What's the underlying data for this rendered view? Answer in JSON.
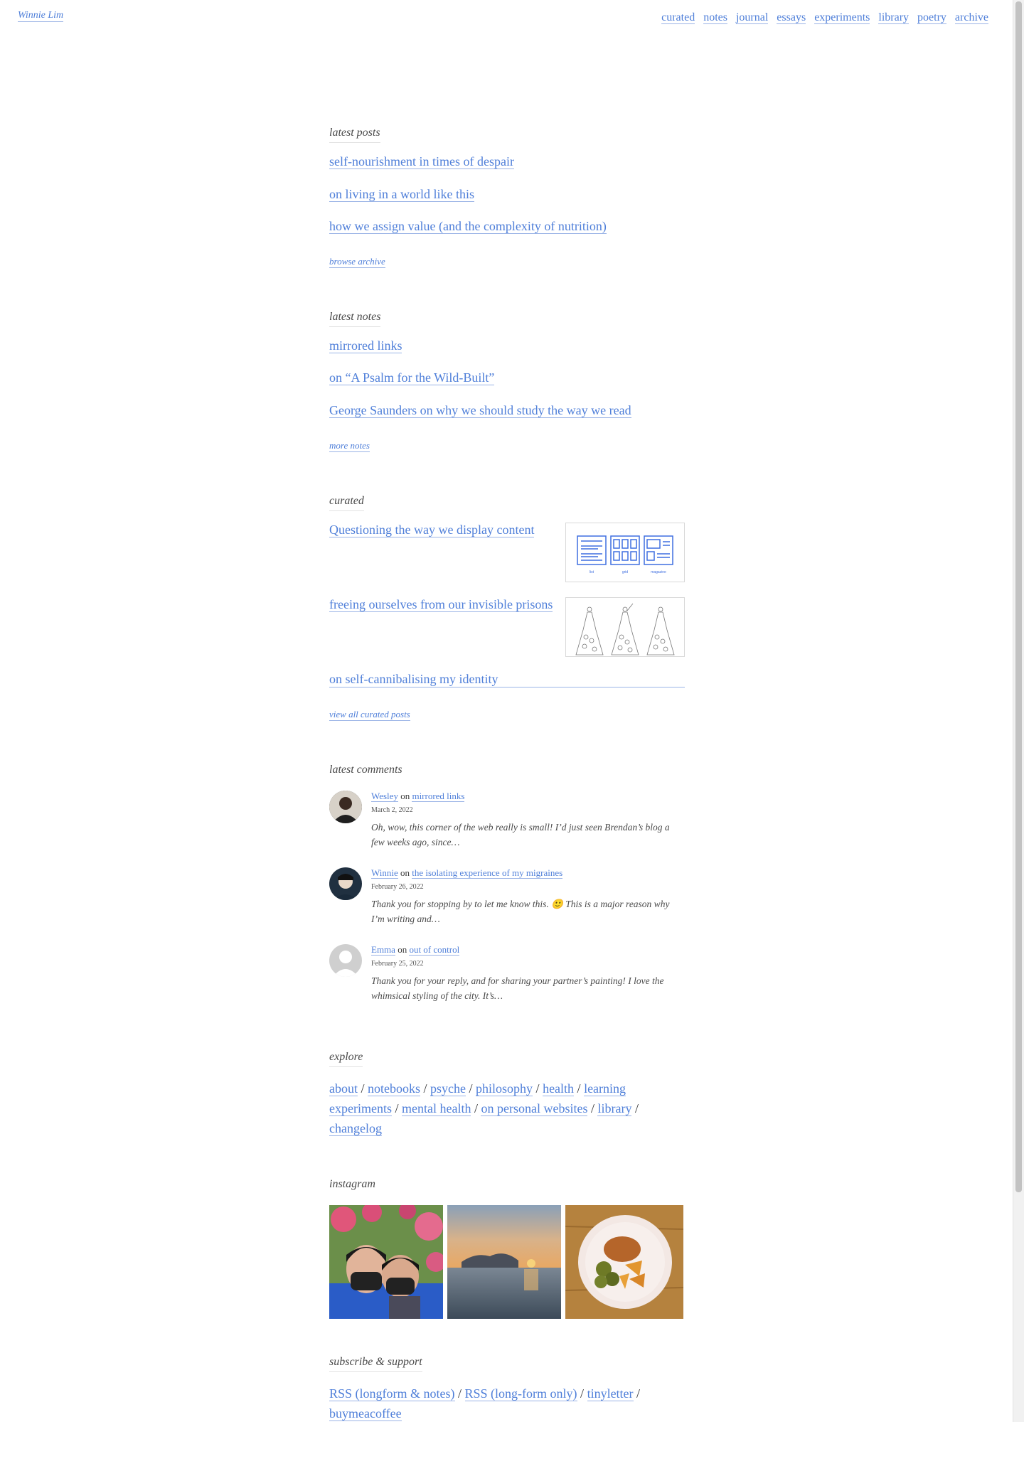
{
  "site": {
    "title": "Winnie Lim"
  },
  "nav": [
    "curated",
    "notes",
    "journal",
    "essays",
    "experiments",
    "library",
    "poetry",
    "archive"
  ],
  "latest_posts": {
    "label": "latest posts",
    "items": [
      "self-nourishment in times of despair",
      "on living in a world like this",
      "how we assign value (and the complexity of nutrition)"
    ],
    "more": "browse archive"
  },
  "latest_notes": {
    "label": "latest notes",
    "items": [
      "mirrored links",
      "on “A Psalm for the Wild-Built”",
      "George Saunders on why we should study the way we read"
    ],
    "more": "more notes"
  },
  "curated": {
    "label": "curated",
    "items": [
      {
        "title": "Questioning the way we display content",
        "thumb": "list-grid-magazine-layouts"
      },
      {
        "title": "freeing ourselves from our invisible prisons",
        "thumb": "three-figure-line-drawing"
      },
      {
        "title": "on self-cannibalising my identity"
      }
    ],
    "diagram_labels": [
      "list",
      "grid",
      "magazine"
    ],
    "more": "view all curated posts"
  },
  "comments": {
    "label": "latest comments",
    "on_word": "on",
    "items": [
      {
        "author": "Wesley",
        "post": "mirrored links",
        "date": "March 2, 2022",
        "text": "Oh, wow, this corner of the web really is small! I’d just seen Brendan’s blog a few weeks ago, since…"
      },
      {
        "author": "Winnie",
        "post": "the isolating experience of my migraines",
        "date": "February 26, 2022",
        "text": "Thank you for stopping by to let me know this. 🙂 This is a major reason why I’m writing and…"
      },
      {
        "author": "Emma",
        "post": "out of control",
        "date": "February 25, 2022",
        "text": "Thank you for your reply, and for sharing your partner’s painting! I love the whimsical styling of the city. It’s…"
      }
    ]
  },
  "explore": {
    "label": "explore",
    "links": [
      "about",
      "notebooks",
      "psyche",
      "philosophy",
      "health",
      "learning experiments",
      "mental health",
      "on personal websites",
      "library",
      "changelog"
    ],
    "separator": "/"
  },
  "instagram": {
    "label": "instagram",
    "photos": [
      "selfie-with-masks",
      "sunset-over-sea",
      "plate-of-food"
    ]
  },
  "subscribe": {
    "label": "subscribe & support",
    "links": [
      "RSS (longform & notes)",
      "RSS (long-form only)",
      "tinyletter",
      "buymeacoffee"
    ],
    "separator": "/"
  },
  "colors": {
    "link": "#4f7fd9",
    "text": "#3a3a3a"
  }
}
